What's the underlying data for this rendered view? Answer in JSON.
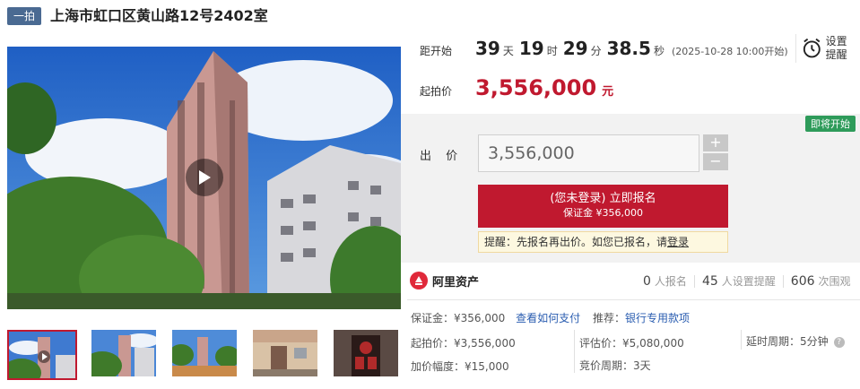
{
  "header": {
    "tag": "一拍",
    "title": "上海市虹口区黄山路12号2402室"
  },
  "countdown": {
    "label": "距开始",
    "days": "39",
    "days_unit": "天",
    "hours": "19",
    "hours_unit": "时",
    "minutes": "29",
    "minutes_unit": "分",
    "seconds": "38.5",
    "seconds_unit": "秒",
    "start_time": "(2025-10-28 10:00开始)"
  },
  "remind": {
    "label": "设置提醒",
    "icon": "alarm-clock-icon"
  },
  "price": {
    "label": "起拍价",
    "value": "3,556,000",
    "unit": "元",
    "color": "#c0192f"
  },
  "bid": {
    "badge": "即将开始",
    "label": "出 价",
    "input_value": "3,556,000",
    "plus": "+",
    "minus": "−",
    "apply_line1": "(您未登录) 立即报名",
    "apply_line2": "保证金 ¥356,000",
    "hint_text": "提醒：先报名再出价。如您已报名，请",
    "hint_link": "登录"
  },
  "brand": {
    "name": "阿里资产"
  },
  "stats": [
    {
      "value": "0",
      "label": "人报名"
    },
    {
      "value": "45",
      "label": "人设置提醒"
    },
    {
      "value": "606",
      "label": "次围观"
    }
  ],
  "details": {
    "deposit": "保证金：¥356,000",
    "how_to_pay": "查看如何支付",
    "recommend_label": "推荐：",
    "recommend_link": "银行专用款项",
    "start_price": "起拍价：¥3,556,000",
    "appraisal": "评估价：¥5,080,000",
    "delay_period": "延时周期：5分钟",
    "increment": "加价幅度：¥15,000",
    "bid_period": "竞价周期：3天"
  }
}
